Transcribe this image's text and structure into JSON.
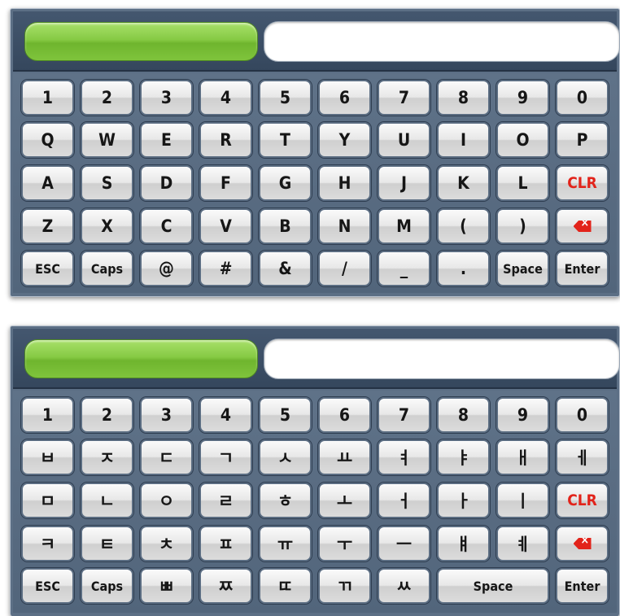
{
  "colors": {
    "clr": "#e2231a",
    "indicator": "#86ca44",
    "panel": "#5c6f85"
  },
  "english": {
    "input_value": "",
    "rows": [
      [
        "1",
        "2",
        "3",
        "4",
        "5",
        "6",
        "7",
        "8",
        "9",
        "0"
      ],
      [
        "Q",
        "W",
        "E",
        "R",
        "T",
        "Y",
        "U",
        "I",
        "O",
        "P"
      ],
      [
        "A",
        "S",
        "D",
        "F",
        "G",
        "H",
        "J",
        "K",
        "L",
        "CLR"
      ],
      [
        "Z",
        "X",
        "C",
        "V",
        "B",
        "N",
        "M",
        "(",
        ")",
        "backspace"
      ],
      [
        "ESC",
        "Caps",
        "@",
        "#",
        "&",
        "/",
        "_",
        ".",
        "Space",
        "Enter"
      ]
    ]
  },
  "korean": {
    "input_value": "",
    "rows": [
      [
        "1",
        "2",
        "3",
        "4",
        "5",
        "6",
        "7",
        "8",
        "9",
        "0"
      ],
      [
        "ㅂ",
        "ㅈ",
        "ㄷ",
        "ㄱ",
        "ㅅ",
        "ㅛ",
        "ㅕ",
        "ㅑ",
        "ㅐ",
        "ㅔ"
      ],
      [
        "ㅁ",
        "ㄴ",
        "ㅇ",
        "ㄹ",
        "ㅎ",
        "ㅗ",
        "ㅓ",
        "ㅏ",
        "ㅣ",
        "CLR"
      ],
      [
        "ㅋ",
        "ㅌ",
        "ㅊ",
        "ㅍ",
        "ㅠ",
        "ㅜ",
        "ㅡ",
        "ㅒ",
        "ㅖ",
        "backspace"
      ],
      [
        "ESC",
        "Caps",
        "ㅃ",
        "ㅉ",
        "ㄸ",
        "ㄲ",
        "ㅆ",
        "Space",
        "Enter"
      ]
    ]
  },
  "icons": {
    "backspace": "backspace-icon"
  }
}
